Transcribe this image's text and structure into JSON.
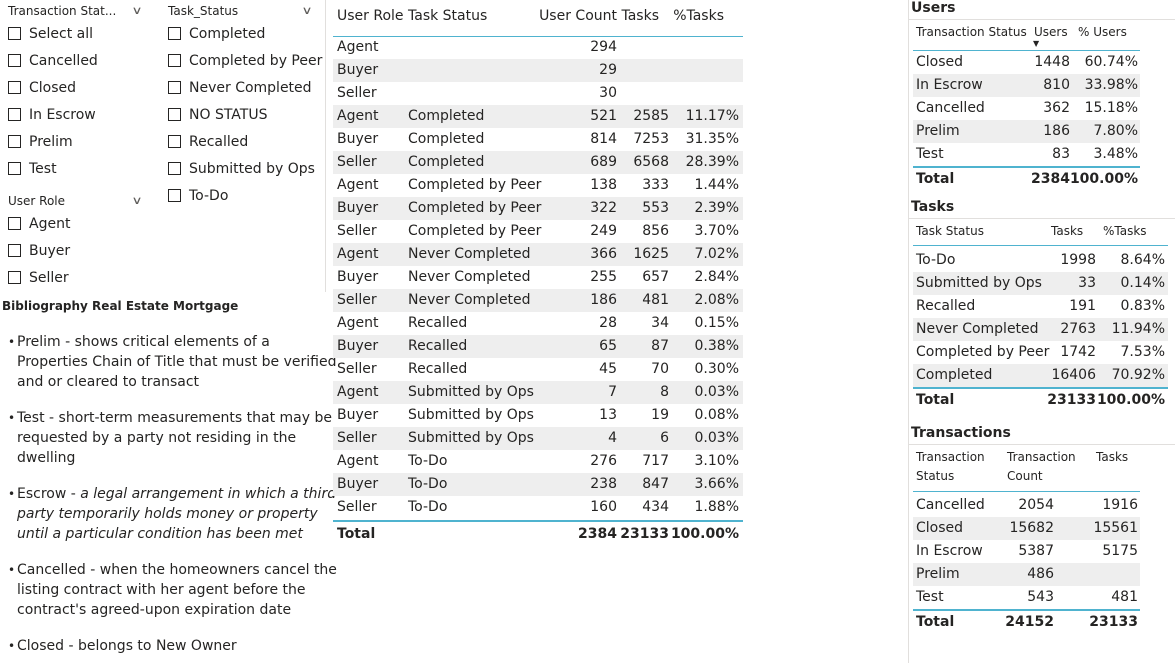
{
  "slicers": {
    "transaction_status": {
      "title": "Transaction Stat...",
      "items": [
        "Select all",
        "Cancelled",
        "Closed",
        "In Escrow",
        "Prelim",
        "Test"
      ]
    },
    "task_status": {
      "title": "Task_Status",
      "items": [
        "Completed",
        "Completed by Peer",
        "Never Completed",
        "NO STATUS",
        "Recalled",
        "Submitted by Ops",
        "To-Do"
      ]
    },
    "user_role": {
      "title": "User Role",
      "items": [
        "Agent",
        "Buyer",
        "Seller"
      ]
    }
  },
  "bibliography": {
    "title": "Bibliography Real Estate Mortgage",
    "items": [
      {
        "text": "Prelim - shows critical elements of a Properties Chain of Title that must be verified and or cleared to transact"
      },
      {
        "text": "Test - short-term measurements that may be requested by a party not residing in the dwelling"
      },
      {
        "prefix": "Escrow - ",
        "italic": "a legal arrangement in which a third party temporarily holds money or property until a particular condition has been met"
      },
      {
        "text": "Cancelled - when the homeowners cancel the listing contract with her agent before the contract's agreed-upon expiration date"
      },
      {
        "text": "Closed - belongs to New Owner"
      }
    ]
  },
  "main_table": {
    "headers": {
      "role": "User Role",
      "status": "Task Status",
      "users": "User Count",
      "tasks": "Tasks",
      "pct": "%Tasks"
    },
    "rows": [
      {
        "role": "Agent",
        "status": "",
        "users": "294",
        "tasks": "",
        "pct": ""
      },
      {
        "role": "Buyer",
        "status": "",
        "users": "29",
        "tasks": "",
        "pct": ""
      },
      {
        "role": "Seller",
        "status": "",
        "users": "30",
        "tasks": "",
        "pct": ""
      },
      {
        "role": "Agent",
        "status": "Completed",
        "users": "521",
        "tasks": "2585",
        "pct": "11.17%"
      },
      {
        "role": "Buyer",
        "status": "Completed",
        "users": "814",
        "tasks": "7253",
        "pct": "31.35%"
      },
      {
        "role": "Seller",
        "status": "Completed",
        "users": "689",
        "tasks": "6568",
        "pct": "28.39%"
      },
      {
        "role": "Agent",
        "status": "Completed by Peer",
        "users": "138",
        "tasks": "333",
        "pct": "1.44%"
      },
      {
        "role": "Buyer",
        "status": "Completed by Peer",
        "users": "322",
        "tasks": "553",
        "pct": "2.39%"
      },
      {
        "role": "Seller",
        "status": "Completed by Peer",
        "users": "249",
        "tasks": "856",
        "pct": "3.70%"
      },
      {
        "role": "Agent",
        "status": "Never Completed",
        "users": "366",
        "tasks": "1625",
        "pct": "7.02%"
      },
      {
        "role": "Buyer",
        "status": "Never Completed",
        "users": "255",
        "tasks": "657",
        "pct": "2.84%"
      },
      {
        "role": "Seller",
        "status": "Never Completed",
        "users": "186",
        "tasks": "481",
        "pct": "2.08%"
      },
      {
        "role": "Agent",
        "status": "Recalled",
        "users": "28",
        "tasks": "34",
        "pct": "0.15%"
      },
      {
        "role": "Buyer",
        "status": "Recalled",
        "users": "65",
        "tasks": "87",
        "pct": "0.38%"
      },
      {
        "role": "Seller",
        "status": "Recalled",
        "users": "45",
        "tasks": "70",
        "pct": "0.30%"
      },
      {
        "role": "Agent",
        "status": "Submitted by Ops",
        "users": "7",
        "tasks": "8",
        "pct": "0.03%"
      },
      {
        "role": "Buyer",
        "status": "Submitted by Ops",
        "users": "13",
        "tasks": "19",
        "pct": "0.08%"
      },
      {
        "role": "Seller",
        "status": "Submitted by Ops",
        "users": "4",
        "tasks": "6",
        "pct": "0.03%"
      },
      {
        "role": "Agent",
        "status": "To-Do",
        "users": "276",
        "tasks": "717",
        "pct": "3.10%"
      },
      {
        "role": "Buyer",
        "status": "To-Do",
        "users": "238",
        "tasks": "847",
        "pct": "3.66%"
      },
      {
        "role": "Seller",
        "status": "To-Do",
        "users": "160",
        "tasks": "434",
        "pct": "1.88%"
      }
    ],
    "total": {
      "label": "Total",
      "users": "2384",
      "tasks": "23133",
      "pct": "100.00%"
    }
  },
  "users_table": {
    "title": "Users",
    "headers": {
      "status": "Transaction Status",
      "users": "Users",
      "pct": "% Users"
    },
    "rows": [
      {
        "status": "Closed",
        "users": "1448",
        "pct": "60.74%"
      },
      {
        "status": "In Escrow",
        "users": "810",
        "pct": "33.98%"
      },
      {
        "status": "Cancelled",
        "users": "362",
        "pct": "15.18%"
      },
      {
        "status": "Prelim",
        "users": "186",
        "pct": "7.80%"
      },
      {
        "status": "Test",
        "users": "83",
        "pct": "3.48%"
      }
    ],
    "total": {
      "label": "Total",
      "users": "2384",
      "pct": "100.00%"
    }
  },
  "tasks_table": {
    "title": "Tasks",
    "headers": {
      "status": "Task Status",
      "tasks": "Tasks",
      "pct": "%Tasks"
    },
    "rows": [
      {
        "status": "To-Do",
        "tasks": "1998",
        "pct": "8.64%"
      },
      {
        "status": "Submitted by Ops",
        "tasks": "33",
        "pct": "0.14%"
      },
      {
        "status": "Recalled",
        "tasks": "191",
        "pct": "0.83%"
      },
      {
        "status": "Never Completed",
        "tasks": "2763",
        "pct": "11.94%"
      },
      {
        "status": "Completed by Peer",
        "tasks": "1742",
        "pct": "7.53%"
      },
      {
        "status": "Completed",
        "tasks": "16406",
        "pct": "70.92%"
      }
    ],
    "total": {
      "label": "Total",
      "tasks": "23133",
      "pct": "100.00%"
    }
  },
  "transactions_table": {
    "title": "Transactions",
    "headers": {
      "status_1": "Transaction",
      "status_2": "Status",
      "count_1": "Transaction",
      "count_2": "Count",
      "tasks": "Tasks"
    },
    "rows": [
      {
        "status": "Cancelled",
        "count": "2054",
        "tasks": "1916"
      },
      {
        "status": "Closed",
        "count": "15682",
        "tasks": "15561"
      },
      {
        "status": "In Escrow",
        "count": "5387",
        "tasks": "5175"
      },
      {
        "status": "Prelim",
        "count": "486",
        "tasks": ""
      },
      {
        "status": "Test",
        "count": "543",
        "tasks": "481"
      }
    ],
    "total": {
      "label": "Total",
      "count": "24152",
      "tasks": "23133"
    }
  },
  "colors": {
    "accent": "#4fb3cf",
    "row_shade": "#eeeeee",
    "text": "#252423"
  }
}
